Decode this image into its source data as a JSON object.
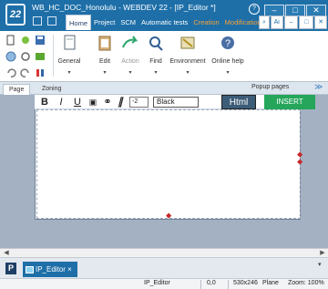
{
  "window": {
    "title": "WB_HC_DOC_Honolulu - WEBDEV 22 - [IP_Editor *]",
    "logo_text": "22",
    "help_glyph": "?",
    "minimize_glyph": "–",
    "maximize_glyph": "□",
    "close_glyph": "✕"
  },
  "menu": {
    "items": [
      "Home",
      "Project",
      "SCM",
      "Automatic tests",
      "Creation",
      "Modification"
    ],
    "active": "Home",
    "extra": "Ai"
  },
  "ribbon": {
    "groups": [
      {
        "label": "General",
        "icon": "document-icon"
      },
      {
        "label": "Edit",
        "icon": "clipboard-icon"
      },
      {
        "label": "Action",
        "icon": "arrow-action-icon"
      },
      {
        "label": "Find",
        "icon": "magnifier-icon"
      },
      {
        "label": "Environment",
        "icon": "environment-icon"
      },
      {
        "label": "Online help",
        "icon": "help-book-icon"
      }
    ],
    "dropdown_glyph": "▾"
  },
  "panel_tabs": {
    "items": [
      "Page",
      "Zoning"
    ],
    "active": "Page",
    "popup_pages": "Popup pages",
    "chevron": "≫"
  },
  "editor_toolbar": {
    "bold": "B",
    "italic": "I",
    "underline": "U",
    "image": "▣",
    "link": "⚭",
    "format_clear": "∥",
    "font_size": "-2",
    "text_color": "Black",
    "html_label": "Html",
    "insert_label": "INSERT"
  },
  "doc_tabs": {
    "project_logo": "P",
    "open_tab": "IP_Editor",
    "close_glyph": "×"
  },
  "status": {
    "element": "IP_Editor",
    "coords": "0,0",
    "size": "530x246",
    "plane": "Plane",
    "zoom": "Zoom: 100%"
  },
  "colors": {
    "title_bar": "#1e6fa8",
    "insert_button": "#25a65a",
    "html_button": "#3d5c78",
    "accent_orange": "#f4a23a"
  }
}
